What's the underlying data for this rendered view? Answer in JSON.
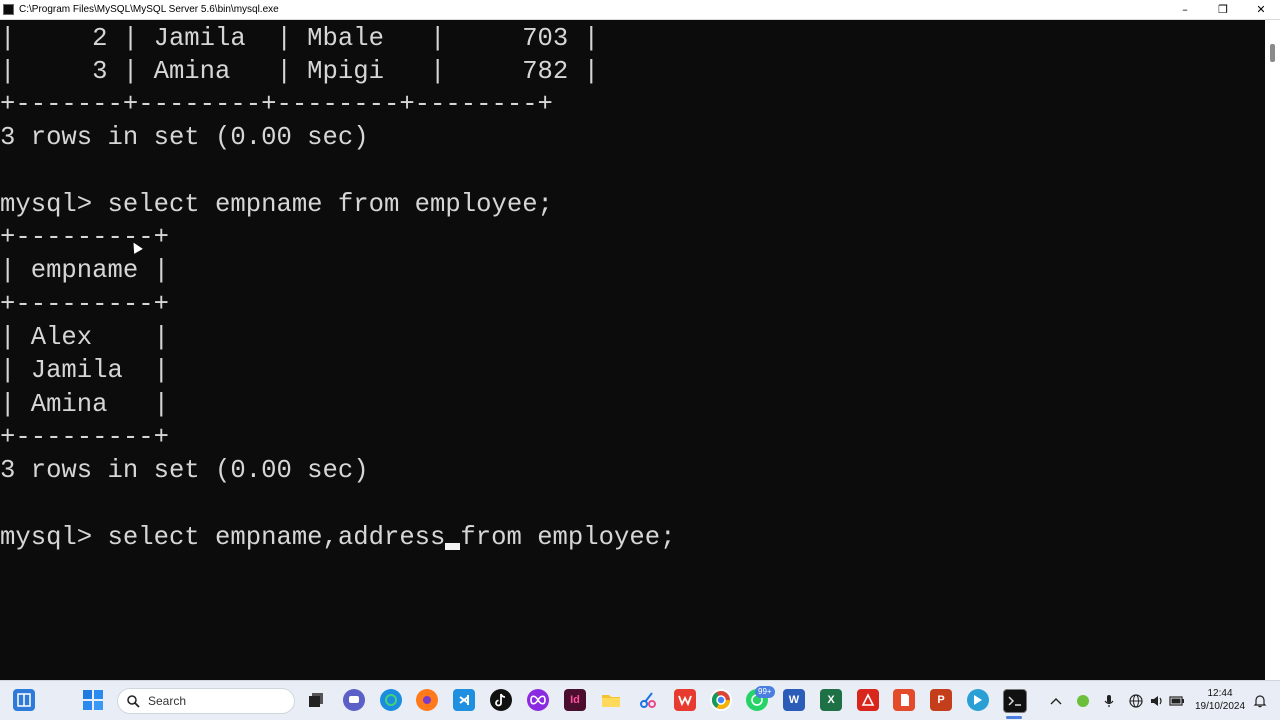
{
  "window": {
    "title": "C:\\Program Files\\MySQL\\MySQL Server 5.6\\bin\\mysql.exe"
  },
  "window_controls": {
    "minimize": "–",
    "maximize": "❐",
    "close": "✕"
  },
  "console": {
    "lines": [
      "|     2 | Jamila  | Mbale   |     703 |",
      "|     3 | Amina   | Mpigi   |     782 |",
      "+-------+--------+--------+--------+",
      "3 rows in set (0.00 sec)",
      "",
      "mysql> select empname from employee;",
      "+---------+",
      "| empname |",
      "+---------+",
      "| Alex    |",
      "| Jamila  |",
      "| Amina   |",
      "+---------+",
      "3 rows in set (0.00 sec)",
      "",
      "mysql> select empname,address"
    ],
    "current_line_rest": "from employee;"
  },
  "taskbar": {
    "search_placeholder": "Search",
    "notification_badge": "99+",
    "icons": {
      "widgets": "widgets-icon",
      "start": "windows-start-icon",
      "task_view": "task-view-icon",
      "chat": "chat-icon",
      "edge": "edge-icon",
      "firefox": "firefox-icon",
      "vscode": "vscode-icon",
      "tiktok": "tiktok-icon",
      "app_infinity": "infinity-app-icon",
      "indesign": "indesign-icon",
      "explorer": "file-explorer-icon",
      "snipping": "snipping-tool-icon",
      "wps": "wps-office-icon",
      "chrome": "chrome-icon",
      "whatsapp": "whatsapp-icon",
      "word": "word-icon",
      "excel": "excel-icon",
      "acrobat": "acrobat-icon",
      "pdf_reader": "pdf-reader-icon",
      "powerpoint": "powerpoint-icon",
      "media": "media-player-icon",
      "terminal": "terminal-icon"
    },
    "clock": {
      "time": "12:44",
      "date": "19/10/2024"
    }
  },
  "colors": {
    "console_bg": "#0c0c0c",
    "console_text": "#d6d6d6",
    "taskbar_bg": "#e9eef6",
    "accent": "#4a7ee0"
  }
}
